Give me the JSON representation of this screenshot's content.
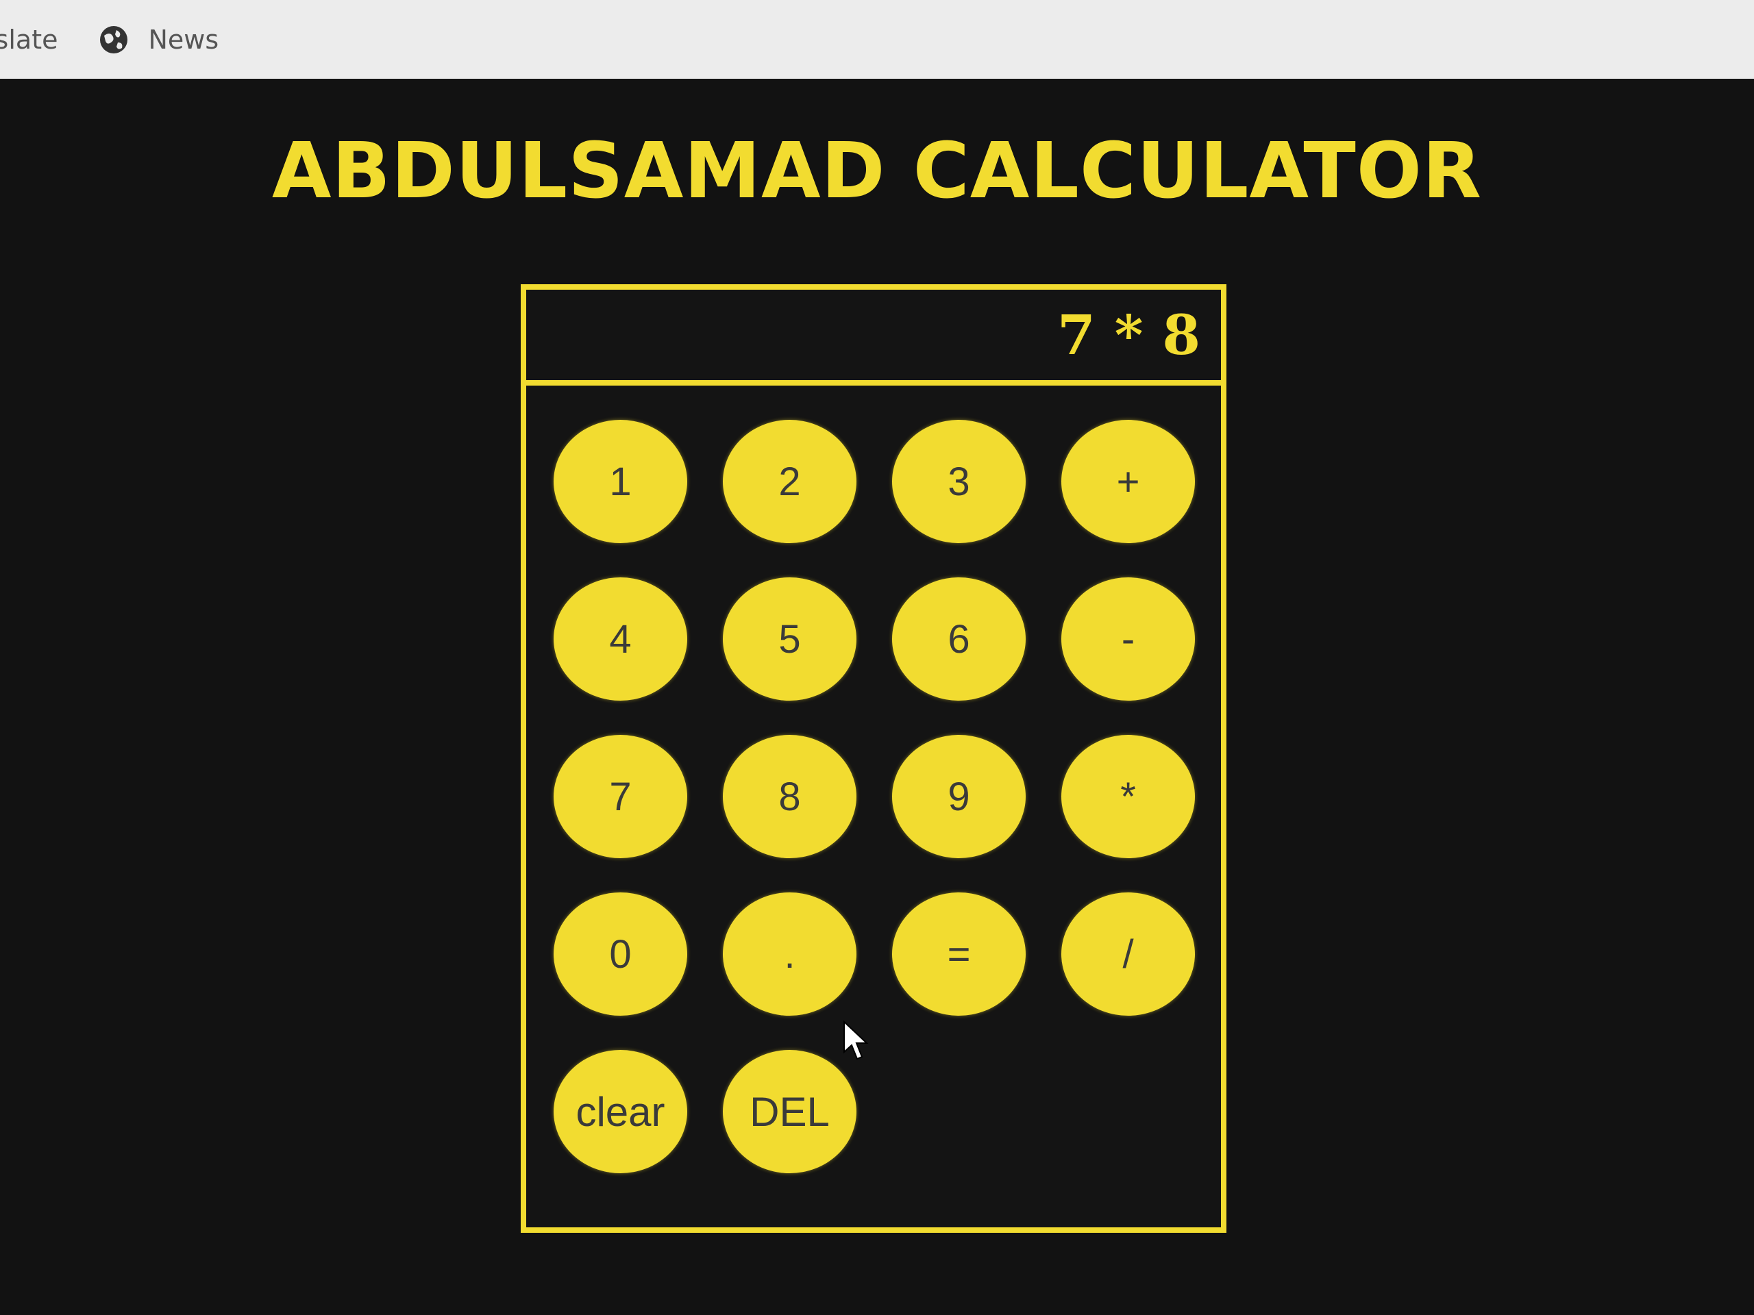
{
  "browser": {
    "bookmarks": [
      {
        "label": "islate"
      },
      {
        "label": "News"
      }
    ]
  },
  "app": {
    "title": "ABDULSAMAD CALCULATOR",
    "display_value": "7 * 8",
    "keys": [
      "1",
      "2",
      "3",
      "+",
      "4",
      "5",
      "6",
      "-",
      "7",
      "8",
      "9",
      "*",
      "0",
      ".",
      "=",
      "/",
      "clear",
      "DEL"
    ]
  },
  "colors": {
    "accent": "#f2dc30",
    "background": "#121212"
  }
}
